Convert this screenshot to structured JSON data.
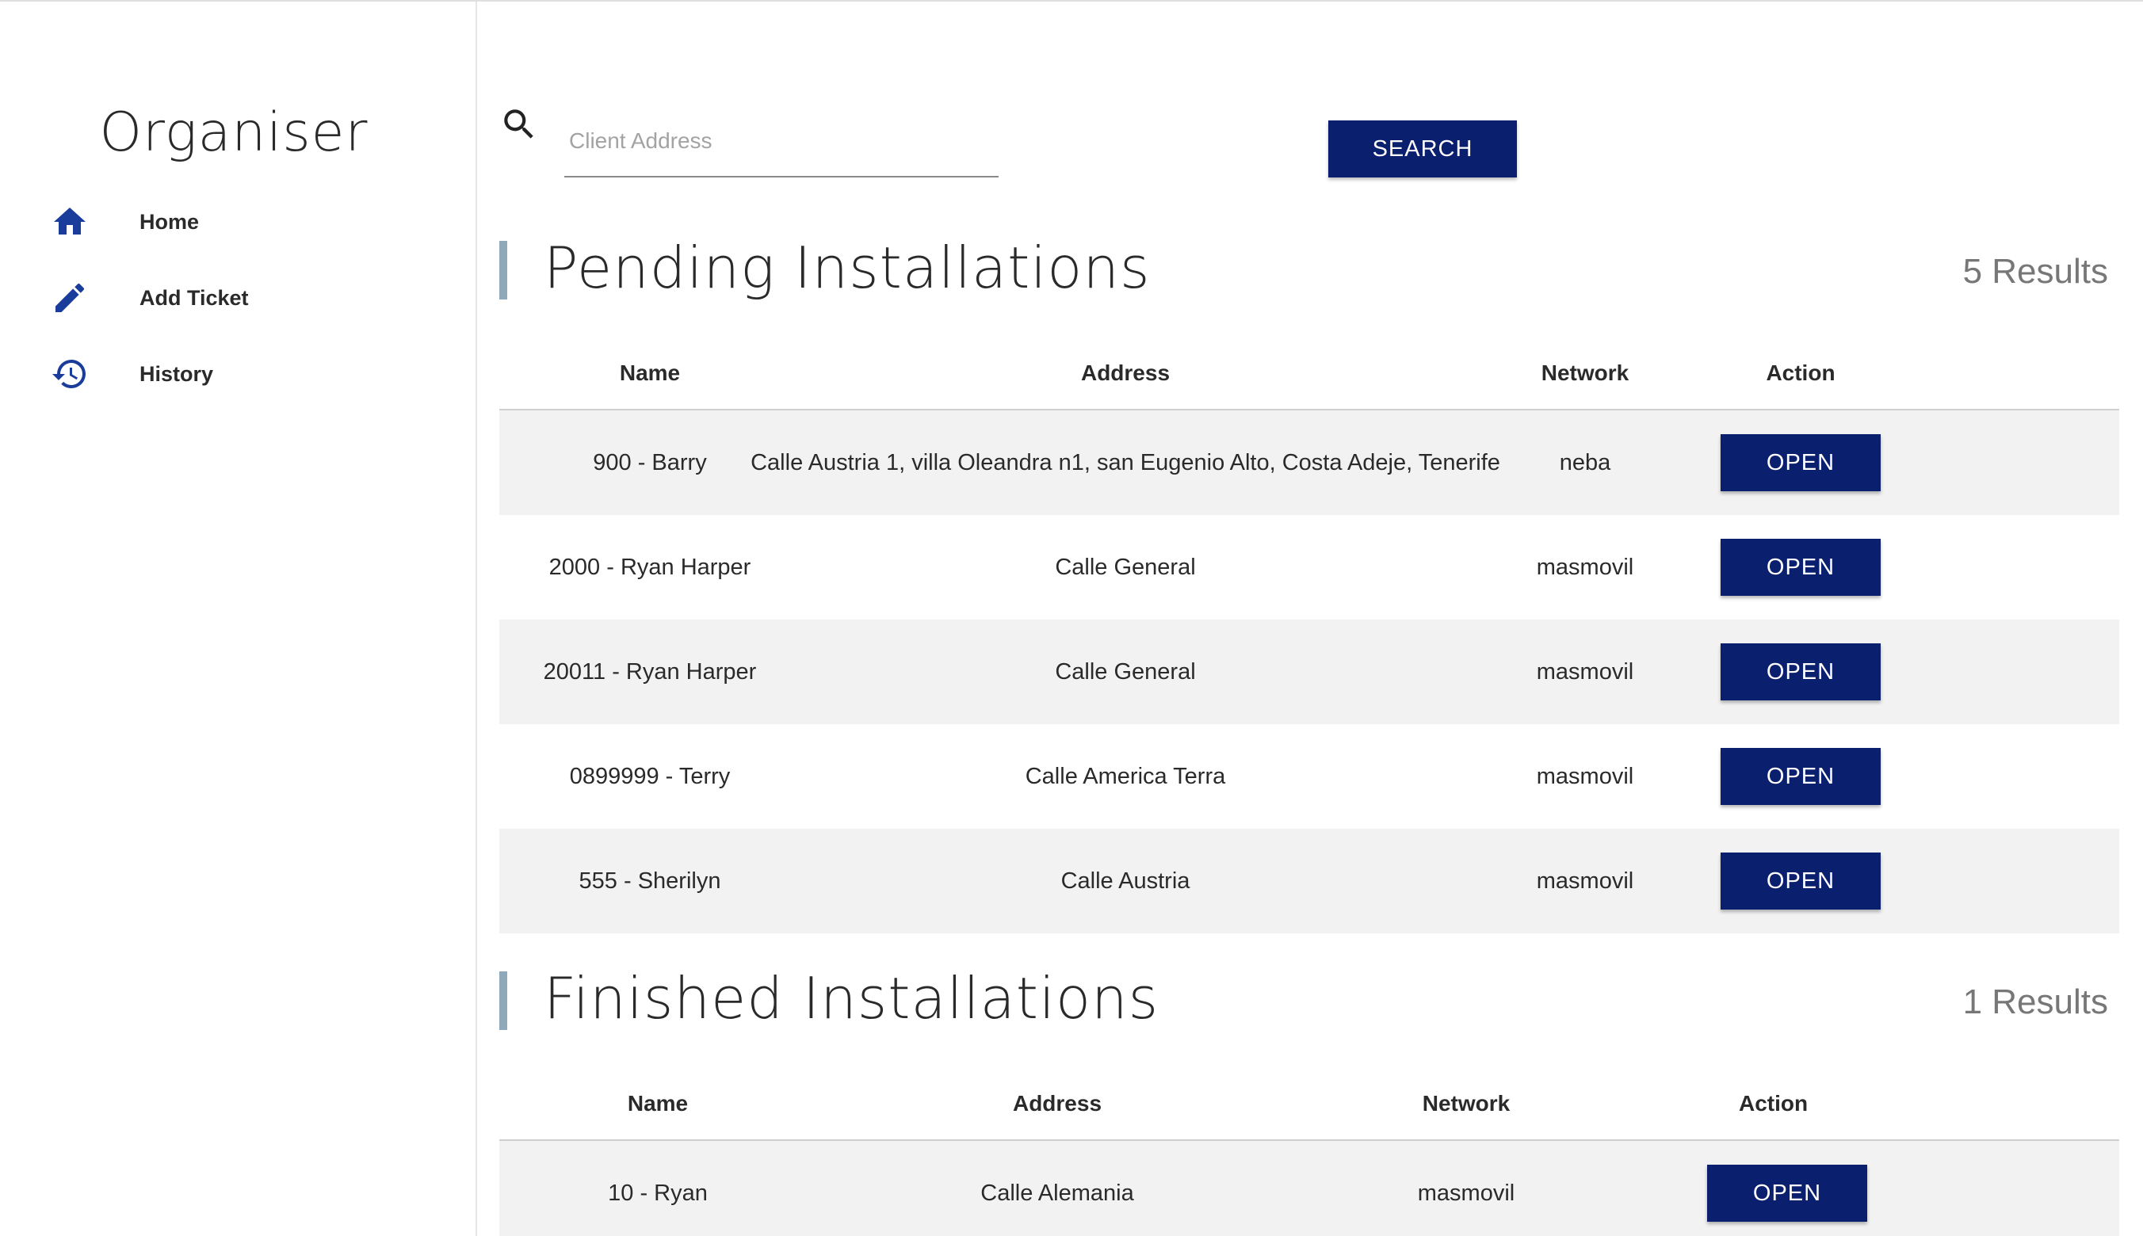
{
  "app": {
    "title": "Organiser"
  },
  "sidebar": {
    "items": [
      {
        "label": "Home",
        "icon": "home-icon"
      },
      {
        "label": "Add Ticket",
        "icon": "pencil-icon"
      },
      {
        "label": "History",
        "icon": "history-icon"
      }
    ]
  },
  "search": {
    "placeholder": "Client Address",
    "value": "",
    "button_label": "SEARCH",
    "icon": "search-icon"
  },
  "colors": {
    "accent": "#0a1f6e",
    "section_bar": "#8fa8ba",
    "row_shade": "#f2f2f2",
    "icon_blue": "#1a3d9c"
  },
  "pending": {
    "title": "Pending Installations",
    "count": "5 Results",
    "columns": [
      "Name",
      "Address",
      "Network",
      "Action"
    ],
    "rows": [
      {
        "name": "900 - Barry",
        "address": "Calle Austria 1, villa Oleandra n1, san Eugenio Alto, Costa Adeje, Tenerife",
        "network": "neba",
        "action": "OPEN"
      },
      {
        "name": "2000 - Ryan Harper",
        "address": "Calle General",
        "network": "masmovil",
        "action": "OPEN"
      },
      {
        "name": "20011 - Ryan Harper",
        "address": "Calle General",
        "network": "masmovil",
        "action": "OPEN"
      },
      {
        "name": "0899999 - Terry",
        "address": "Calle America Terra",
        "network": "masmovil",
        "action": "OPEN"
      },
      {
        "name": "555 - Sherilyn",
        "address": "Calle Austria",
        "network": "masmovil",
        "action": "OPEN"
      }
    ]
  },
  "finished": {
    "title": "Finished Installations",
    "count": "1 Results",
    "columns": [
      "Name",
      "Address",
      "Network",
      "Action"
    ],
    "rows": [
      {
        "name": "10 - Ryan",
        "address": "Calle Alemania",
        "network": "masmovil",
        "action": "OPEN"
      }
    ]
  }
}
